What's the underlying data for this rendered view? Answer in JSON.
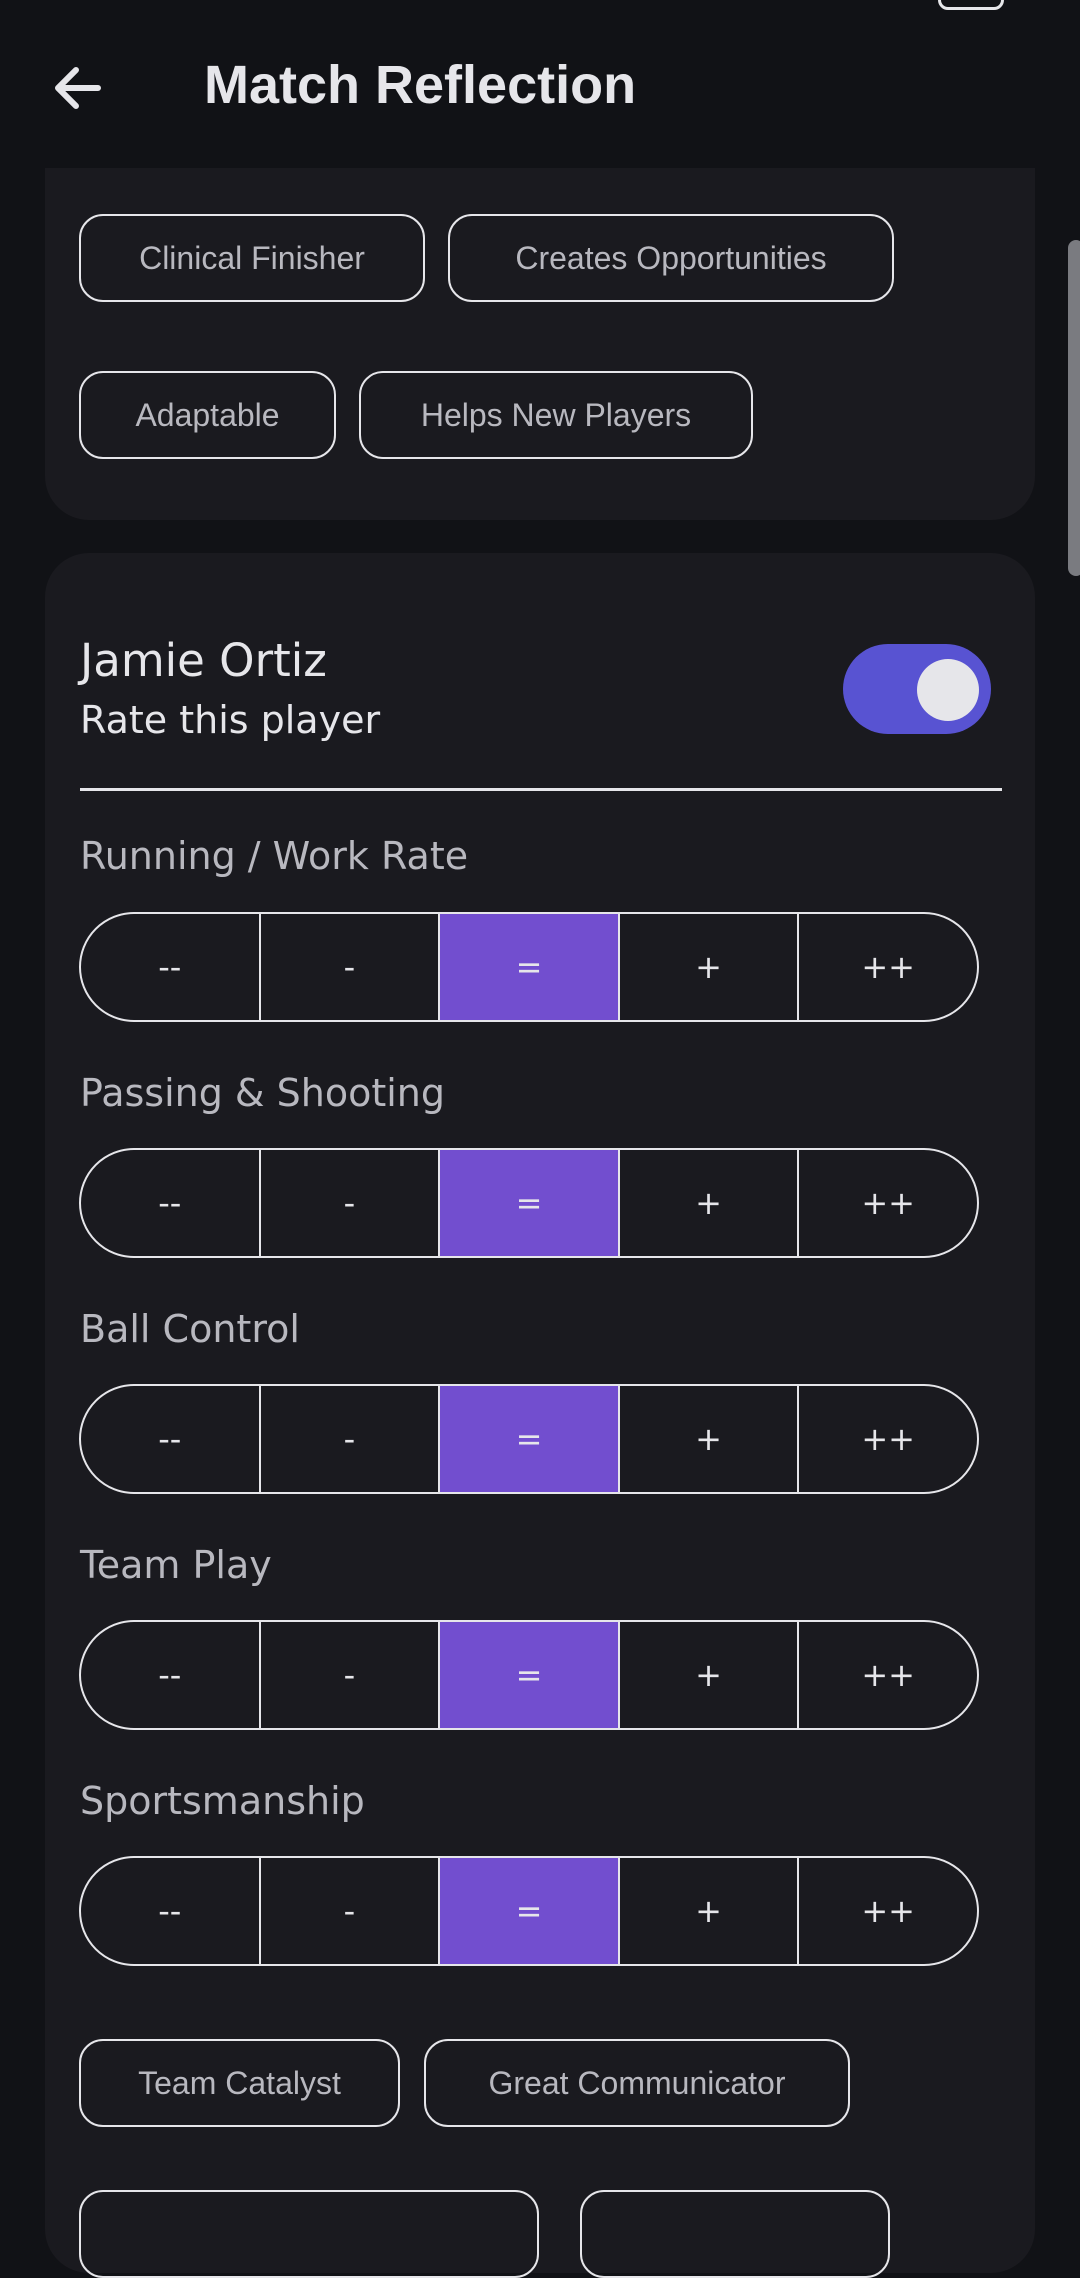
{
  "header": {
    "title": "Match Reflection",
    "back_icon": "arrow-left-icon"
  },
  "top_card": {
    "chips": [
      "Clinical Finisher",
      "Creates Opportunities",
      "Adaptable",
      "Helps New Players"
    ]
  },
  "player": {
    "name": "Jamie Ortiz",
    "subtitle": "Rate this player",
    "toggle_on": true,
    "ratings": [
      {
        "label": "Running / Work Rate",
        "options": [
          "--",
          "-",
          "=",
          "+",
          "++"
        ],
        "selected": "="
      },
      {
        "label": "Passing & Shooting",
        "options": [
          "--",
          "-",
          "=",
          "+",
          "++"
        ],
        "selected": "="
      },
      {
        "label": "Ball Control",
        "options": [
          "--",
          "-",
          "=",
          "+",
          "++"
        ],
        "selected": "="
      },
      {
        "label": "Team Play",
        "options": [
          "--",
          "-",
          "=",
          "+",
          "++"
        ],
        "selected": "="
      },
      {
        "label": "Sportsmanship",
        "options": [
          "--",
          "-",
          "=",
          "+",
          "++"
        ],
        "selected": "="
      }
    ],
    "chips": [
      "Team Catalyst",
      "Great Communicator"
    ]
  },
  "colors": {
    "background": "#111216",
    "card": "#1a1a1f",
    "accent_toggle": "#5853d2",
    "selected_segment": "#724ecf",
    "text": "#e6e6ea",
    "muted_text": "#b8b8bf"
  }
}
